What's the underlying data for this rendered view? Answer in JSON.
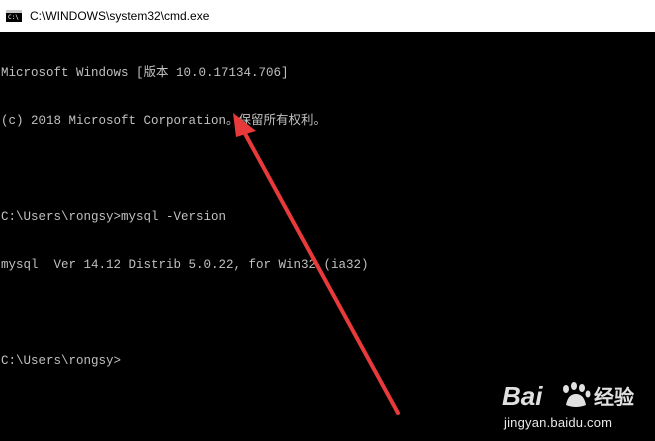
{
  "window": {
    "title": "C:\\WINDOWS\\system32\\cmd.exe",
    "icon": "cmd-app-icon",
    "icon_text": "C:\\"
  },
  "console": {
    "lines": [
      "Microsoft Windows [版本 10.0.17134.706]",
      "(c) 2018 Microsoft Corporation。保留所有权利。",
      "",
      "C:\\Users\\rongsy>mysql -Version",
      "mysql  Ver 14.12 Distrib 5.0.22, for Win32 (ia32)",
      "",
      "C:\\Users\\rongsy>"
    ]
  },
  "annotation": {
    "arrow_color": "#e83a3a"
  },
  "watermark": {
    "brand_left": "Bai",
    "brand_right": "经验",
    "url": "jingyan.baidu.com"
  }
}
